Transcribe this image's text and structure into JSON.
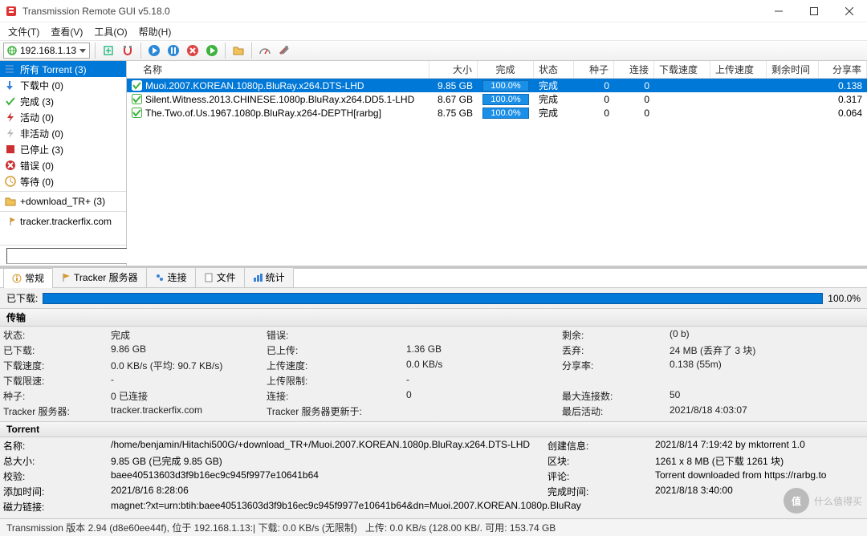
{
  "window": {
    "title": "Transmission Remote GUI v5.18.0"
  },
  "menu": {
    "file": "文件(T)",
    "view": "查看(V)",
    "tools": "工具(O)",
    "help": "帮助(H)"
  },
  "toolbar": {
    "ip": "192.168.1.13"
  },
  "sidebar": {
    "filters": [
      {
        "name": "all",
        "label": "所有 Torrent (3)",
        "selected": true,
        "color": "#0078d7",
        "shape": "bar"
      },
      {
        "name": "downloading",
        "label": "下载中 (0)",
        "color": "#3a82d8",
        "shape": "down"
      },
      {
        "name": "completed",
        "label": "完成 (3)",
        "color": "#3fb23f",
        "shape": "check"
      },
      {
        "name": "active",
        "label": "活动 (0)",
        "color": "#cb2f2f",
        "shape": "bolt"
      },
      {
        "name": "inactive",
        "label": "非活动 (0)",
        "color": "#cb2f2f",
        "shape": "pause"
      },
      {
        "name": "stopped",
        "label": "已停止 (3)",
        "color": "#cb2f2f",
        "shape": "stop"
      },
      {
        "name": "error",
        "label": "错误 (0)",
        "color": "#cb2f2f",
        "shape": "x"
      },
      {
        "name": "waiting",
        "label": "等待 (0)",
        "color": "#d59a2d",
        "shape": "clock"
      }
    ],
    "folders": [
      {
        "label": "+download_TR+ (3)"
      }
    ],
    "trackers": [
      {
        "label": "tracker.trackerfix.com"
      }
    ]
  },
  "columns": {
    "name": "名称",
    "size": "大小",
    "done": "完成",
    "status": "状态",
    "seeds": "种子",
    "peers": "连接",
    "dlspeed": "下载速度",
    "ulspeed": "上传速度",
    "eta": "剩余时间",
    "ratio": "分享率"
  },
  "torrents": [
    {
      "name": "Muoi.2007.KOREAN.1080p.BluRay.x264.DTS-LHD",
      "size": "9.85 GB",
      "done": "100.0%",
      "status": "完成",
      "seeds": "0",
      "peers": "0",
      "dlspeed": "",
      "ulspeed": "",
      "eta": "",
      "ratio": "0.138",
      "selected": true
    },
    {
      "name": "Silent.Witness.2013.CHINESE.1080p.BluRay.x264.DD5.1-LHD",
      "size": "8.67 GB",
      "done": "100.0%",
      "status": "完成",
      "seeds": "0",
      "peers": "0",
      "dlspeed": "",
      "ulspeed": "",
      "eta": "",
      "ratio": "0.317"
    },
    {
      "name": "The.Two.of.Us.1967.1080p.BluRay.x264-DEPTH[rarbg]",
      "size": "8.75 GB",
      "done": "100.0%",
      "status": "完成",
      "seeds": "0",
      "peers": "0",
      "dlspeed": "",
      "ulspeed": "",
      "eta": "",
      "ratio": "0.064"
    }
  ],
  "tabs": {
    "general": "常规",
    "trackers": "Tracker 服务器",
    "peers": "连接",
    "files": "文件",
    "stats": "统计"
  },
  "progress": {
    "label": "已下载:",
    "pct": "100.0%"
  },
  "sections": {
    "transfer": "传输",
    "torrent": "Torrent"
  },
  "transfer": {
    "k_status": "状态:",
    "v_status": "完成",
    "k_error": "错误:",
    "v_error": "",
    "k_remain": "剩余:",
    "v_remain": "(0 b)",
    "k_downloaded": "已下载:",
    "v_downloaded": "9.86 GB",
    "k_uploaded": "已上传:",
    "v_uploaded": "1.36 GB",
    "k_wasted": "丢弃:",
    "v_wasted": "24 MB (丢弃了 3 块)",
    "k_dlspeed": "下载速度:",
    "v_dlspeed": "0.0 KB/s (平均: 90.7 KB/s)",
    "k_ulspeed": "上传速度:",
    "v_ulspeed": "0.0 KB/s",
    "k_ratio": "分享率:",
    "v_ratio": "0.138 (55m)",
    "k_dllimit": "下载限速:",
    "v_dllimit": "-",
    "k_ullimit": "上传限制:",
    "v_ullimit": "-",
    "k_blank3": "",
    "v_blank3": "",
    "k_seeds": "种子:",
    "v_seeds": "0 已连接",
    "k_peers": "连接:",
    "v_peers": "0",
    "k_maxpeers": "最大连接数:",
    "v_maxpeers": "50",
    "k_tracker": "Tracker 服务器:",
    "v_tracker": "tracker.trackerfix.com",
    "k_trackerupd": "Tracker 服务器更新于:",
    "v_trackerupd": "",
    "k_lastact": "最后活动:",
    "v_lastact": "2021/8/18 4:03:07"
  },
  "torrent_info": {
    "k_name": "名称:",
    "v_name": "/home/benjamin/Hitachi500G/+download_TR+/Muoi.2007.KOREAN.1080p.BluRay.x264.DTS-LHD",
    "k_created": "创建信息:",
    "v_created": "2021/8/14 7:19:42 by mktorrent 1.0",
    "k_totalsize": "总大小:",
    "v_totalsize": "9.85 GB (已完成 9.85 GB)",
    "k_pieces": "区块:",
    "v_pieces": "1261 x 8 MB (已下载 1261 块)",
    "k_hash": "校验:",
    "v_hash": "baee40513603d3f9b16ec9c945f9977e10641b64",
    "k_comment": "评论:",
    "v_comment": "Torrent downloaded from https://rarbg.to",
    "k_added": "添加时间:",
    "v_added": "2021/8/16 8:28:06",
    "k_completed": "完成时间:",
    "v_completed": "2021/8/18 3:40:00",
    "k_magnet": "磁力链接:",
    "v_magnet": "magnet:?xt=urn:btih:baee40513603d3f9b16ec9c945f9977e10641b64&dn=Muoi.2007.KOREAN.1080p.BluRay"
  },
  "statusbar": {
    "left": "Transmission 版本 2.94 (d8e60ee44f), 位于 192.168.1.13:| 下载: 0.0 KB/s (无限制)",
    "mid": "上传: 0.0 KB/s (128.00 KB/. 可用: 153.74 GB"
  },
  "watermark": "什么值得买"
}
